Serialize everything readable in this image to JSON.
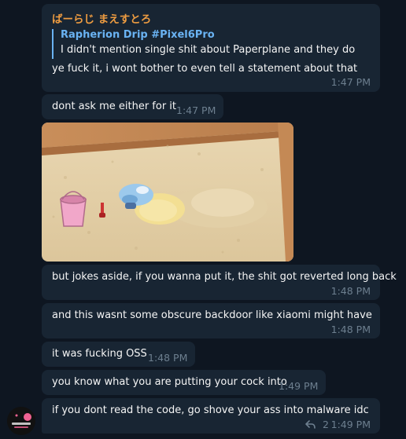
{
  "messages": {
    "m1": {
      "sender": "ばーらじ まえすとろ",
      "reply_author": "Rapherion Drip #Pixel6Pro",
      "reply_text": "I didn't mention single shit about Paperplane and they do",
      "text": "ye fuck it, i wont bother to even tell a statement about that",
      "time": "1:47 PM"
    },
    "m2": {
      "text": "dont ask me either for it",
      "time": "1:47 PM"
    },
    "m3": {
      "text": "but jokes aside, if you wanna put it, the shit got reverted long back",
      "time": "1:48 PM"
    },
    "m4": {
      "text": "and this wasnt some obscure backdoor like xiaomi might have",
      "time": "1:48 PM"
    },
    "m5": {
      "text": "it was fucking OSS",
      "time": "1:48 PM"
    },
    "m6": {
      "text": "you know what you are putting your cock into",
      "time": "1:49 PM"
    },
    "m7": {
      "text": "if you dont read the code, go shove your ass into malware idc",
      "time": "1:49 PM",
      "replies_count": "2"
    }
  },
  "icons": {
    "reply_arrow": "reply-arrow-icon"
  },
  "colors": {
    "background": "#0e1621",
    "bubble": "#182533",
    "sender_name": "#ee9c41",
    "reply_accent": "#6ab3f3",
    "timestamp": "#6d7f8f"
  }
}
